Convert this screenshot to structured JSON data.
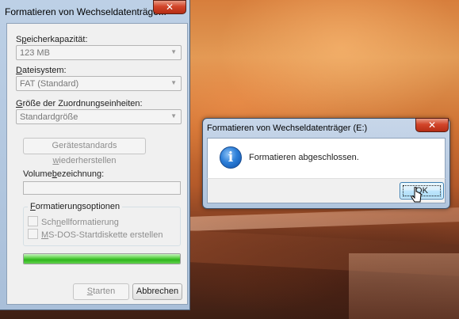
{
  "format_window": {
    "title": "Formatieren von Wechseldatenträge...",
    "close_label": "✕",
    "capacity": {
      "label_prefix": "S",
      "label_accel": "p",
      "label_rest": "eicherkapazität:",
      "value": "123 MB"
    },
    "filesystem": {
      "label_accel": "D",
      "label_rest": "ateisystem:",
      "value": "FAT (Standard)"
    },
    "allocation": {
      "label_accel": "G",
      "label_rest": "röße der Zuordnungseinheiten:",
      "value": "Standardgröße"
    },
    "restore_defaults": {
      "prefix": "Gerätestandards ",
      "accel": "w",
      "rest": "iederherstellen"
    },
    "volume_label": {
      "prefix": "Volume",
      "accel": "b",
      "rest": "ezeichnung:",
      "value": ""
    },
    "options": {
      "title_accel": "F",
      "title_rest": "ormatierungsoptionen",
      "quick": {
        "prefix": "Sch",
        "accel": "n",
        "rest": "ellformatierung"
      },
      "msdos": {
        "accel": "M",
        "rest": "S-DOS-Startdiskette erstellen"
      }
    },
    "progress_percent": 100,
    "start": {
      "accel": "S",
      "rest": "tarten"
    },
    "cancel_label": "Abbrechen"
  },
  "message_dialog": {
    "title": "Formatieren von Wechseldatenträger (E:)",
    "close_label": "✕",
    "icon": "info-icon",
    "icon_glyph": "i",
    "message": "Formatieren abgeschlossen.",
    "ok_accel": "O",
    "ok_rest": "K"
  },
  "colors": {
    "accent": "#3c7fb1",
    "close_red": "#d2452a",
    "progress_green": "#2fb51c"
  }
}
